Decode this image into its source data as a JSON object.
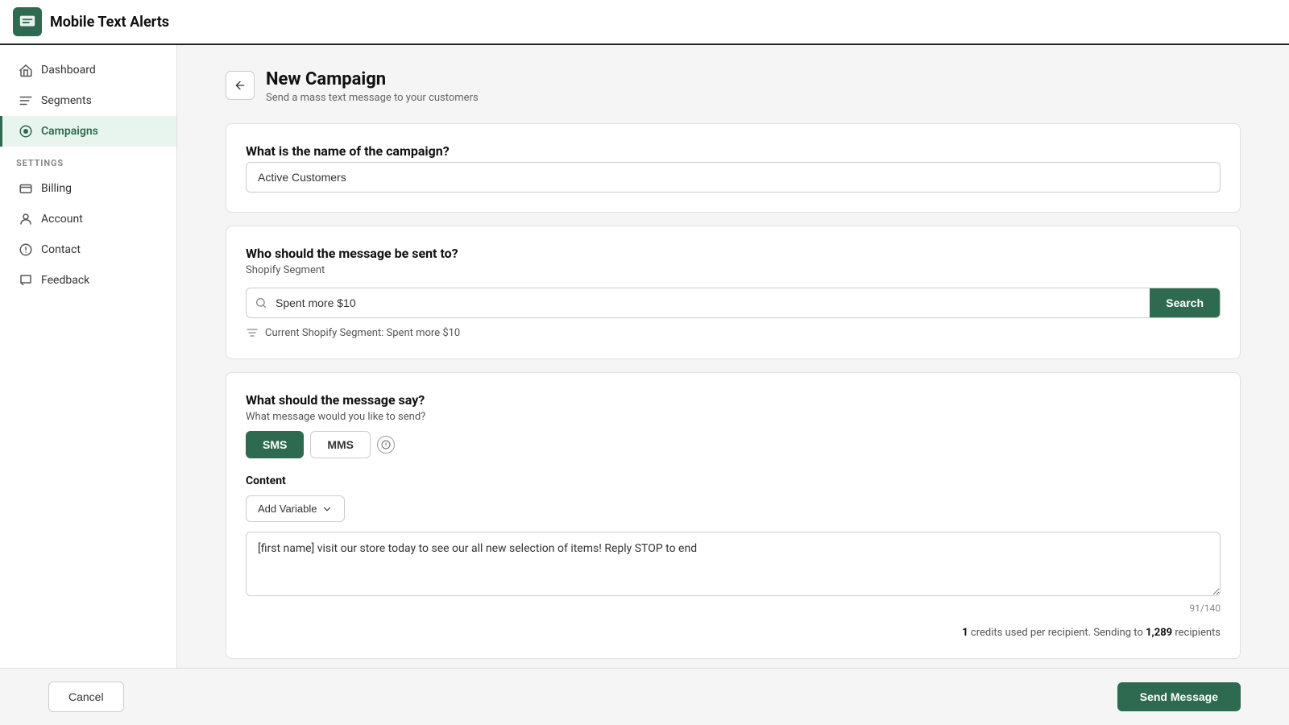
{
  "app": {
    "name": "Mobile Text Alerts"
  },
  "sidebar": {
    "nav_items": [
      {
        "id": "dashboard",
        "label": "Dashboard",
        "icon": "home-icon",
        "active": false
      },
      {
        "id": "segments",
        "label": "Segments",
        "icon": "segments-icon",
        "active": false
      },
      {
        "id": "campaigns",
        "label": "Campaigns",
        "icon": "campaigns-icon",
        "active": true
      }
    ],
    "settings_label": "SETTINGS",
    "settings_items": [
      {
        "id": "billing",
        "label": "Billing",
        "icon": "billing-icon"
      },
      {
        "id": "account",
        "label": "Account",
        "icon": "account-icon"
      },
      {
        "id": "contact",
        "label": "Contact",
        "icon": "contact-icon"
      },
      {
        "id": "feedback",
        "label": "Feedback",
        "icon": "feedback-icon"
      }
    ]
  },
  "page": {
    "title": "New Campaign",
    "subtitle": "Send a mass text message to your customers"
  },
  "campaign_name_section": {
    "title": "What is the name of the campaign?",
    "input_value": "Active Customers",
    "input_placeholder": "Campaign name"
  },
  "recipients_section": {
    "title": "Who should the message be sent to?",
    "subtitle": "Shopify Segment",
    "search_value": "Spent more $10",
    "search_placeholder": "Search segments",
    "search_button_label": "Search",
    "current_segment_label": "Current Shopify Segment: Spent more $10"
  },
  "message_section": {
    "title": "What should the message say?",
    "message_type_label": "What message would you like to send?",
    "sms_label": "SMS",
    "mms_label": "MMS",
    "content_label": "Content",
    "add_variable_label": "Add Variable",
    "message_text": "[first name] visit our store today to see our all new selection of items! Reply STOP to end",
    "char_count": "91/140",
    "credits_text": "1",
    "credits_suffix": " credits used per recipient. Sending to ",
    "recipients_count": "1,289",
    "recipients_suffix": " recipients"
  },
  "footer": {
    "cancel_label": "Cancel",
    "send_label": "Send Message"
  },
  "colors": {
    "brand_green": "#2d6a4f",
    "active_bg": "#e8f5ee"
  }
}
